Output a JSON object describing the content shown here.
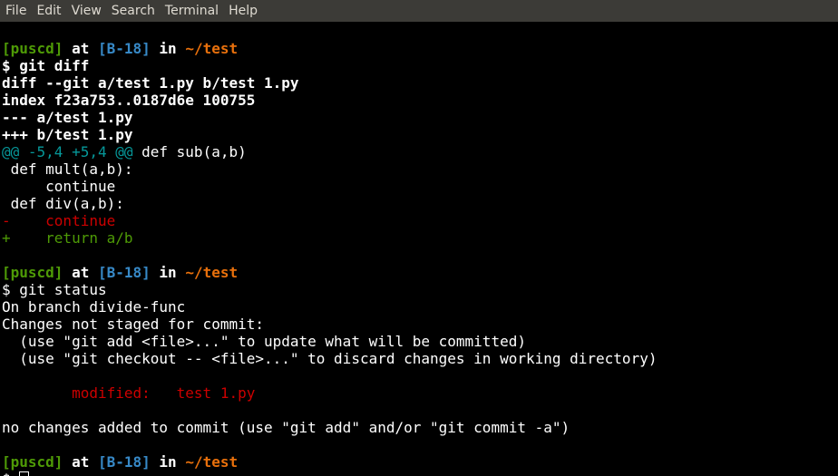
{
  "menubar": {
    "items": [
      "File",
      "Edit",
      "View",
      "Search",
      "Terminal",
      "Help"
    ]
  },
  "prompt": {
    "user": "[puscd]",
    "at": "at",
    "branch": "[B-18]",
    "in": "in",
    "dir": "~/test"
  },
  "colors": {
    "prompt_user": "#4e9a06",
    "prompt_branch": "#3789c7",
    "prompt_dir": "#e8700c",
    "diff_hunk": "#06989a",
    "diff_removed": "#cc0000",
    "diff_added": "#4e9a06",
    "menubar_bg": "#3c3b37"
  },
  "session": {
    "cmd1": "$ git diff",
    "diff_header": [
      "diff --git a/test 1.py b/test 1.py",
      "index f23a753..0187d6e 100755",
      "--- a/test 1.py",
      "+++ b/test 1.py"
    ],
    "hunk_marker": "@@ -5,4 +5,4 @@",
    "hunk_context": " def sub(a,b)",
    "context_lines": [
      " def mult(a,b):",
      "     continue",
      " def div(a,b):"
    ],
    "removed_line": "-    continue",
    "added_line": "+    return a/b",
    "cmd2": "$ git status",
    "status_lines": [
      "On branch divide-func",
      "Changes not staged for commit:",
      "  (use \"git add <file>...\" to update what will be committed)",
      "  (use \"git checkout -- <file>...\" to discard changes in working directory)"
    ],
    "modified_label": "        modified:   test 1.py",
    "no_changes": "no changes added to commit (use \"git add\" and/or \"git commit -a\")",
    "cmd3_prefix": "$ "
  }
}
